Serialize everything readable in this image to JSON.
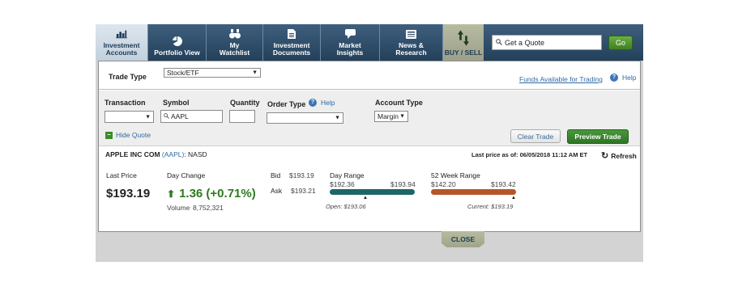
{
  "nav": {
    "tabs": [
      {
        "label_line1": "Investment",
        "label_line2": "Accounts",
        "icon": "bar-chart-icon"
      },
      {
        "label_line1": "Portfolio View",
        "label_line2": "",
        "icon": "pie-chart-icon"
      },
      {
        "label_line1": "My",
        "label_line2": "Watchlist",
        "icon": "binoculars-icon"
      },
      {
        "label_line1": "Investment",
        "label_line2": "Documents",
        "icon": "document-icon"
      },
      {
        "label_line1": "Market",
        "label_line2": "Insights",
        "icon": "speech-bubble-icon"
      },
      {
        "label_line1": "News &",
        "label_line2": "Research",
        "icon": "newspaper-icon"
      }
    ],
    "buy_sell_label": "BUY / SELL",
    "quote_placeholder": "Get a Quote",
    "go_label": "Go"
  },
  "trade": {
    "trade_type_label": "Trade Type",
    "trade_type_value": "Stock/ETF",
    "funds_link": "Funds Available for Trading",
    "help_label": "Help"
  },
  "order": {
    "transaction_label": "Transaction",
    "symbol_label": "Symbol",
    "symbol_value": "AAPL",
    "quantity_label": "Quantity",
    "order_type_label": "Order Type",
    "order_help_label": "Help",
    "account_type_label": "Account Type",
    "account_type_value": "Margin",
    "hide_quote_label": "Hide Quote",
    "clear_label": "Clear Trade",
    "preview_label": "Preview Trade"
  },
  "quote": {
    "name": "APPLE INC COM",
    "symbol": "(AAPL)",
    "exchange": ": NASD",
    "as_of": "Last price as of: 06/05/2018 11:12 AM ET",
    "refresh_label": "Refresh",
    "last_price_label": "Last Price",
    "last_price": "$193.19",
    "day_change_label": "Day Change",
    "day_change": "1.36 (+0.71%)",
    "volume_label": "Volume",
    "volume": "8,752,321",
    "bid_label": "Bid",
    "bid": "$193.19",
    "ask_label": "Ask",
    "ask": "$193.21",
    "day_range_label": "Day Range",
    "day_low": "$192.36",
    "day_high": "$193.94",
    "open_note": "Open: $193.06",
    "week52_label": "52 Week Range",
    "week52_low": "$142.20",
    "week52_high": "$193.42",
    "current_note": "Current: $193.19",
    "day_range_color": "#1e6666",
    "week52_color": "#b5562a"
  },
  "close_label": "CLOSE"
}
